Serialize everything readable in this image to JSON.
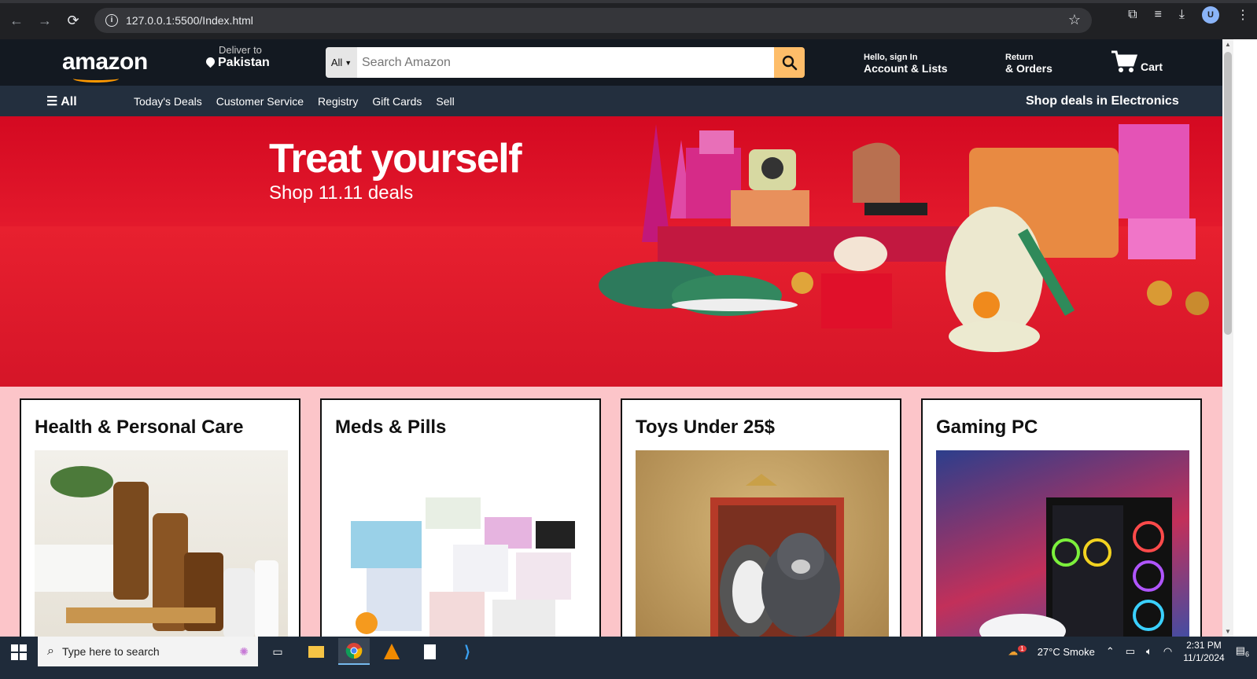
{
  "browser": {
    "url": "127.0.0.1:5500/Index.html",
    "avatar_letter": "U"
  },
  "header": {
    "logo": "amazon",
    "deliver_line1": "Deliver to",
    "deliver_line2": "Pakistan",
    "search_category": "All",
    "search_placeholder": "Search Amazon",
    "account_line1": "Hello, sign In",
    "account_line2": "Account & Lists",
    "orders_line1": "Return",
    "orders_line2": "& Orders",
    "cart_label": "Cart"
  },
  "subnav": {
    "all_label": "All",
    "links": [
      "Today's Deals",
      "Customer Service",
      "Registry",
      "Gift Cards",
      "Sell"
    ],
    "promo": "Shop deals in Electronics"
  },
  "hero": {
    "title": "Treat yourself",
    "subtitle": "Shop 11.11 deals"
  },
  "cards": [
    {
      "title": "Health & Personal Care"
    },
    {
      "title": "Meds & Pills"
    },
    {
      "title": "Toys Under 25$"
    },
    {
      "title": "Gaming PC"
    }
  ],
  "taskbar": {
    "search_placeholder": "Type here to search",
    "weather": "27°C  Smoke",
    "time": "2:31 PM",
    "date": "11/1/2024",
    "notification_count": "6",
    "weather_badge": "1"
  },
  "colors": {
    "header_bg": "#131921",
    "subnav_bg": "#232f3e",
    "search_button": "#febd69",
    "logo_smile": "#ff9900",
    "content_bg": "#fcc5c9",
    "hero_red": "#d40921"
  }
}
